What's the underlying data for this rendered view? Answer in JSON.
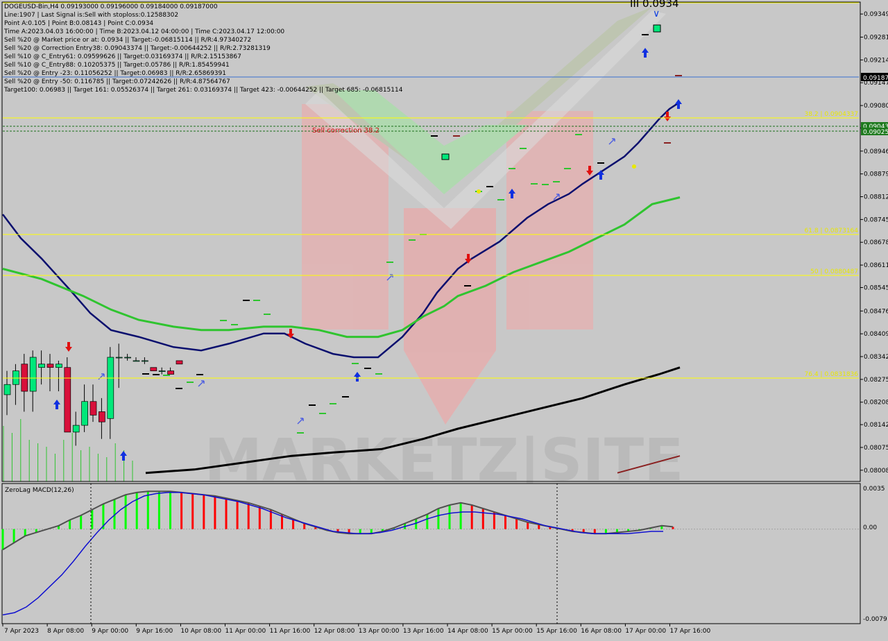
{
  "info_lines": [
    "DOGEUSD-Bin,H4  0.09193000 0.09196000 0.09184000 0.09187000",
    "Line:1907 | Last Signal is:Sell with stoploss:0.12588302",
    "Point A:0.105 | Point B:0.08143 | Point C:0.0934",
    "Time A:2023.04.03 16:00:00 | Time B:2023.04.12 04:00:00 | Time C:2023.04.17 12:00:00",
    "Sell %20 @ Market price or at: 0.0934 || Target:-0.06815114 || R/R:4.97340272",
    "Sell %20 @ Correction Entry38: 0.09043374 || Target:-0.00644252 || R/R:2.73281319",
    "Sell %10 @ C_Entry61: 0.09599626 || Target:0.03169374 || R/R:2.15153867",
    "Sell %10 @ C_Entry88: 0.10205375 || Target:0.05786 || R/R:1.85459941",
    "Sell %20 @ Entry -23: 0.11056252 || Target:0.06983 || R/R:2.65869391",
    "Sell %20 @ Entry -50: 0.116785 || Target:0.07242626 || R/R:4.87564767",
    "Target100: 0.06983 || Target 161: 0.05526374 || Target 261: 0.03169374 || Target 423: -0.00644252 || Target 685: -0.06815114"
  ],
  "price_labels": [
    "0.09349",
    "0.09281",
    "0.09214",
    "0.09147",
    "0.09080",
    "0.09014",
    "0.08946",
    "0.08879",
    "0.08812",
    "0.08745",
    "0.08678",
    "0.08611",
    "0.08545",
    "0.08476",
    "0.08409",
    "0.08342",
    "0.08275",
    "0.08208",
    "0.08142",
    "0.08075",
    "0.08008"
  ],
  "current_price": "0.09187",
  "level_labels": {
    "l1": "0.09043",
    "l2": "0.09025"
  },
  "fib_labels": [
    "38.2 | 0.0904337",
    "61.8 | 0.0873164",
    "50 | 0.0880487",
    "76.4 | 0.0831836"
  ],
  "top_label": "III 0.0934",
  "sell_correction": "Sell correction 38.2",
  "macd_title": "ZeroLag MACD(12,26)",
  "macd_labels": [
    "0.0035",
    "0.00",
    "-0.0079"
  ],
  "watermark": "MARKETZ|SITE",
  "time_labels": [
    "7 Apr 2023",
    "8 Apr 08:00",
    "9 Apr 00:00",
    "9 Apr 16:00",
    "10 Apr 08:00",
    "11 Apr 00:00",
    "11 Apr 16:00",
    "12 Apr 08:00",
    "13 Apr 00:00",
    "13 Apr 16:00",
    "14 Apr 08:00",
    "15 Apr 00:00",
    "15 Apr 16:00",
    "16 Apr 08:00",
    "17 Apr 00:00",
    "17 Apr 16:00"
  ],
  "colors": {
    "bg": "#c8c8c8",
    "bull": "#00e87a",
    "bear": "#d80f3a",
    "ma_blue": "#0a0f6e",
    "ma_green": "#2fc42f",
    "ma_black": "#000000",
    "fib": "#ffff00",
    "macd_pos": "#00ff00",
    "macd_neg": "#ff0000"
  },
  "chart_data": {
    "type": "candlestick",
    "symbol": "DOGEUSD-Bin",
    "timeframe": "H4",
    "ohlc_last": {
      "open": 0.09193,
      "high": 0.09196,
      "low": 0.09184,
      "close": 0.09187
    },
    "ylim": [
      0.07975,
      0.09382
    ],
    "candles": [
      [
        0.0823,
        0.083,
        0.0817,
        0.0826
      ],
      [
        0.0826,
        0.0832,
        0.082,
        0.083
      ],
      [
        0.0832,
        0.0835,
        0.0818,
        0.0824
      ],
      [
        0.0824,
        0.0836,
        0.0818,
        0.0834
      ],
      [
        0.0831,
        0.0836,
        0.0826,
        0.0832
      ],
      [
        0.0832,
        0.0835,
        0.0824,
        0.0831
      ],
      [
        0.0831,
        0.0833,
        0.0824,
        0.0832
      ],
      [
        0.0831,
        0.0834,
        0.0812,
        0.0812
      ],
      [
        0.0812,
        0.0818,
        0.0808,
        0.0814
      ],
      [
        0.0814,
        0.0826,
        0.0812,
        0.0821
      ],
      [
        0.0821,
        0.0826,
        0.0815,
        0.0817
      ],
      [
        0.0818,
        0.0822,
        0.081,
        0.0815
      ],
      [
        0.0816,
        0.0837,
        0.081,
        0.0834
      ],
      [
        0.0834,
        0.0838,
        0.0825,
        0.0834
      ],
      [
        0.0834,
        0.0835,
        0.0833,
        0.0834
      ],
      [
        0.0833,
        0.0834,
        0.0833,
        0.0833
      ],
      [
        0.0833,
        0.0834,
        0.0832,
        0.0833
      ],
      [
        0.0831,
        0.0831,
        0.083,
        0.083
      ],
      [
        0.083,
        0.0831,
        0.0829,
        0.083
      ],
      [
        0.083,
        0.0831,
        0.0829,
        0.0829
      ],
      [
        0.0833,
        0.0833,
        0.0832,
        0.0832
      ]
    ],
    "series": [
      {
        "name": "blue",
        "x": [
          4,
          30,
          60,
          100,
          130,
          160,
          200,
          250,
          290,
          330,
          380,
          410,
          440,
          480,
          510,
          545,
          580,
          610,
          630,
          660,
          680,
          720,
          760,
          790,
          820,
          840,
          870,
          900,
          920,
          950,
          965,
          980
        ],
        "y": [
          0.0876,
          0.0869,
          0.0863,
          0.0854,
          0.0847,
          0.0842,
          0.084,
          0.0837,
          0.0836,
          0.0838,
          0.0841,
          0.0841,
          0.0838,
          0.0835,
          0.0834,
          0.0834,
          0.084,
          0.0847,
          0.0853,
          0.086,
          0.0863,
          0.0868,
          0.0875,
          0.0879,
          0.0882,
          0.0885,
          0.0889,
          0.0893,
          0.0897,
          0.0904,
          0.0907,
          0.0909
        ]
      },
      {
        "name": "green",
        "x": [
          4,
          60,
          120,
          160,
          200,
          250,
          290,
          330,
          380,
          420,
          460,
          500,
          545,
          580,
          610,
          640,
          660,
          700,
          740,
          780,
          820,
          860,
          900,
          940,
          980
        ],
        "y": [
          0.086,
          0.0857,
          0.0852,
          0.0848,
          0.0845,
          0.0843,
          0.0842,
          0.0842,
          0.0843,
          0.0843,
          0.0842,
          0.084,
          0.084,
          0.0842,
          0.0846,
          0.0849,
          0.0852,
          0.0855,
          0.0859,
          0.0862,
          0.0865,
          0.0869,
          0.0873,
          0.0879,
          0.0881
        ]
      },
      {
        "name": "black",
        "x": [
          210,
          280,
          350,
          420,
          480,
          550,
          610,
          660,
          720,
          780,
          840,
          900,
          950,
          980
        ],
        "y": [
          0.08,
          0.0801,
          0.0803,
          0.0805,
          0.0806,
          0.0807,
          0.081,
          0.0813,
          0.0816,
          0.0819,
          0.0822,
          0.0826,
          0.0829,
          0.0831
        ]
      },
      {
        "name": "brown",
        "x": [
          890,
          980
        ],
        "y": [
          0.08,
          0.0805
        ]
      }
    ],
    "fib_levels": [
      0.0904337,
      0.0873164,
      0.0880487,
      0.0831836
    ],
    "macd": {
      "title": "ZeroLag MACD(12,26)",
      "ylim": [
        -0.0082,
        0.0038
      ],
      "hist": [
        -0.0018,
        -0.0012,
        -0.0006,
        -0.0003,
        0.0,
        0.0003,
        0.0008,
        0.0012,
        0.0017,
        0.0022,
        0.0026,
        0.003,
        0.0032,
        0.0033,
        0.0033,
        0.0033,
        0.0032,
        0.0031,
        0.003,
        0.0029,
        0.0027,
        0.0025,
        0.0023,
        0.002,
        0.0017,
        0.0013,
        0.0009,
        0.0005,
        0.0002,
        -0.0001,
        -0.0003,
        -0.0004,
        -0.0004,
        -0.0004,
        -0.0002,
        0.0001,
        0.0005,
        0.0009,
        0.0013,
        0.0018,
        0.0021,
        0.0023,
        0.0021,
        0.0018,
        0.0015,
        0.0012,
        0.0009,
        0.0006,
        0.0004,
        0.0002,
        0.0,
        -0.0002,
        -0.0003,
        -0.0004,
        -0.0004,
        -0.0003,
        -0.0002,
        -0.0001,
        0.0001,
        0.0003,
        0.0002
      ],
      "signal": [
        -0.0075,
        -0.0073,
        -0.0068,
        -0.006,
        -0.005,
        -0.004,
        -0.0028,
        -0.0015,
        -0.0003,
        0.0008,
        0.0017,
        0.0024,
        0.0029,
        0.0031,
        0.0032,
        0.0032,
        0.0031,
        0.003,
        0.0028,
        0.0026,
        0.0024,
        0.0021,
        0.0018,
        0.0014,
        0.001,
        0.0007,
        0.0004,
        0.0001,
        -0.0002,
        -0.0003,
        -0.0004,
        -0.0004,
        -0.0003,
        -0.0001,
        0.0002,
        0.0005,
        0.0009,
        0.0012,
        0.0014,
        0.0015,
        0.0015,
        0.0014,
        0.0013,
        0.0011,
        0.0009,
        0.0006,
        0.0003,
        0.0001,
        -0.0001,
        -0.0003,
        -0.0004,
        -0.0004,
        -0.0004,
        -0.0004,
        -0.0003,
        -0.0002,
        -0.0002
      ]
    }
  }
}
